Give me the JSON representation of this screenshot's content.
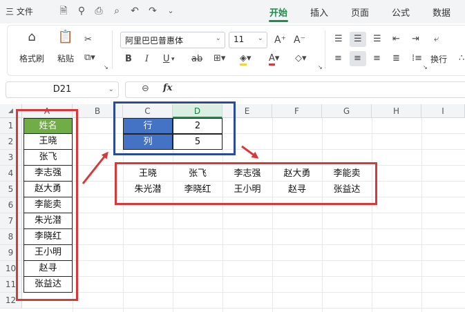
{
  "menu": {
    "file_label": "三 文件",
    "tabs": [
      {
        "label": "开始",
        "active": true
      },
      {
        "label": "插入",
        "active": false
      },
      {
        "label": "页面",
        "active": false
      },
      {
        "label": "公式",
        "active": false
      },
      {
        "label": "数据",
        "active": false
      }
    ]
  },
  "ribbon": {
    "format_painter": "格式刷",
    "paste": "粘贴",
    "font_name": "阿里巴巴普惠体",
    "font_size": "11",
    "wrap": "换行"
  },
  "formula_bar": {
    "cell_ref": "D21",
    "fx": "fx",
    "content": ""
  },
  "columns": [
    "A",
    "B",
    "C",
    "D",
    "E",
    "F",
    "G",
    "H",
    "I"
  ],
  "selected_column": "D",
  "rows": [
    "1",
    "2",
    "3",
    "4",
    "5",
    "6",
    "7",
    "8",
    "9",
    "10",
    "11",
    "12"
  ],
  "column_a": {
    "header": "姓名",
    "names": [
      "王晓",
      "张飞",
      "李志强",
      "赵大勇",
      "李能卖",
      "朱光潜",
      "李晓红",
      "王小明",
      "赵寻",
      "张益达"
    ]
  },
  "params": [
    {
      "label": "行",
      "value": "2"
    },
    {
      "label": "列",
      "value": "5"
    }
  ],
  "result": [
    [
      "王晓",
      "张飞",
      "李志强",
      "赵大勇",
      "李能卖"
    ],
    [
      "朱光潜",
      "李晓红",
      "王小明",
      "赵寻",
      "张益达"
    ]
  ],
  "colors": {
    "accent_green": "#1b8f4a",
    "header_green": "#70ad47",
    "label_blue": "#4472c4",
    "annotation_red": "#d9383a",
    "annotation_blue": "#2a4a9c"
  }
}
